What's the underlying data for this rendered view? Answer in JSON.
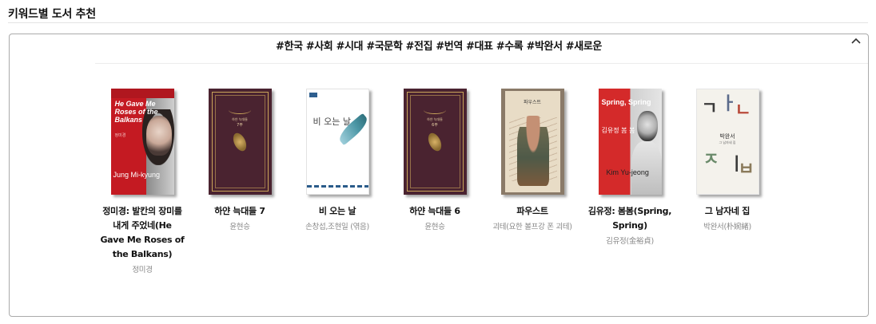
{
  "section": {
    "title": "키워드별 도서 추천"
  },
  "keywords": "#한국 #사회 #시대 #국문학 #전집 #번역 #대표 #수록 #박완서 #새로운",
  "books": [
    {
      "title": "정미경: 발칸의 장미를 내게 주었네(He Gave Me Roses of the Balkans)",
      "author": "정미경",
      "cover": {
        "title": "He Gave Me Roses of the Balkans",
        "name": "Jung Mi-kyung",
        "kr_title": "정미경"
      }
    },
    {
      "title": "하얀 늑대들 7",
      "author": "윤현승",
      "cover": {
        "title": "하얀 늑대들",
        "volume": "7부"
      }
    },
    {
      "title": "비 오는 날",
      "author": "손창섭,조현일 (엮음)",
      "cover": {
        "title": "비 오는 날"
      }
    },
    {
      "title": "하얀 늑대들 6",
      "author": "윤현승",
      "cover": {
        "title": "하얀 늑대들",
        "volume": "6부"
      }
    },
    {
      "title": "파우스트",
      "author": "괴테(요한 볼프강 폰 괴테)",
      "cover": {
        "title": "파우스트"
      }
    },
    {
      "title": "김유정: 봄봄(Spring, Spring)",
      "author": "김유정(金裕貞)",
      "cover": {
        "title": "Spring, Spring",
        "kr_title": "김유정 봄 봄",
        "name": "Kim Yu-jeong"
      }
    },
    {
      "title": "그 남자네 집",
      "author": "박완서(朴婉緖)",
      "cover": {
        "title": "박완서",
        "subtitle": "그 남자네 집"
      }
    }
  ]
}
